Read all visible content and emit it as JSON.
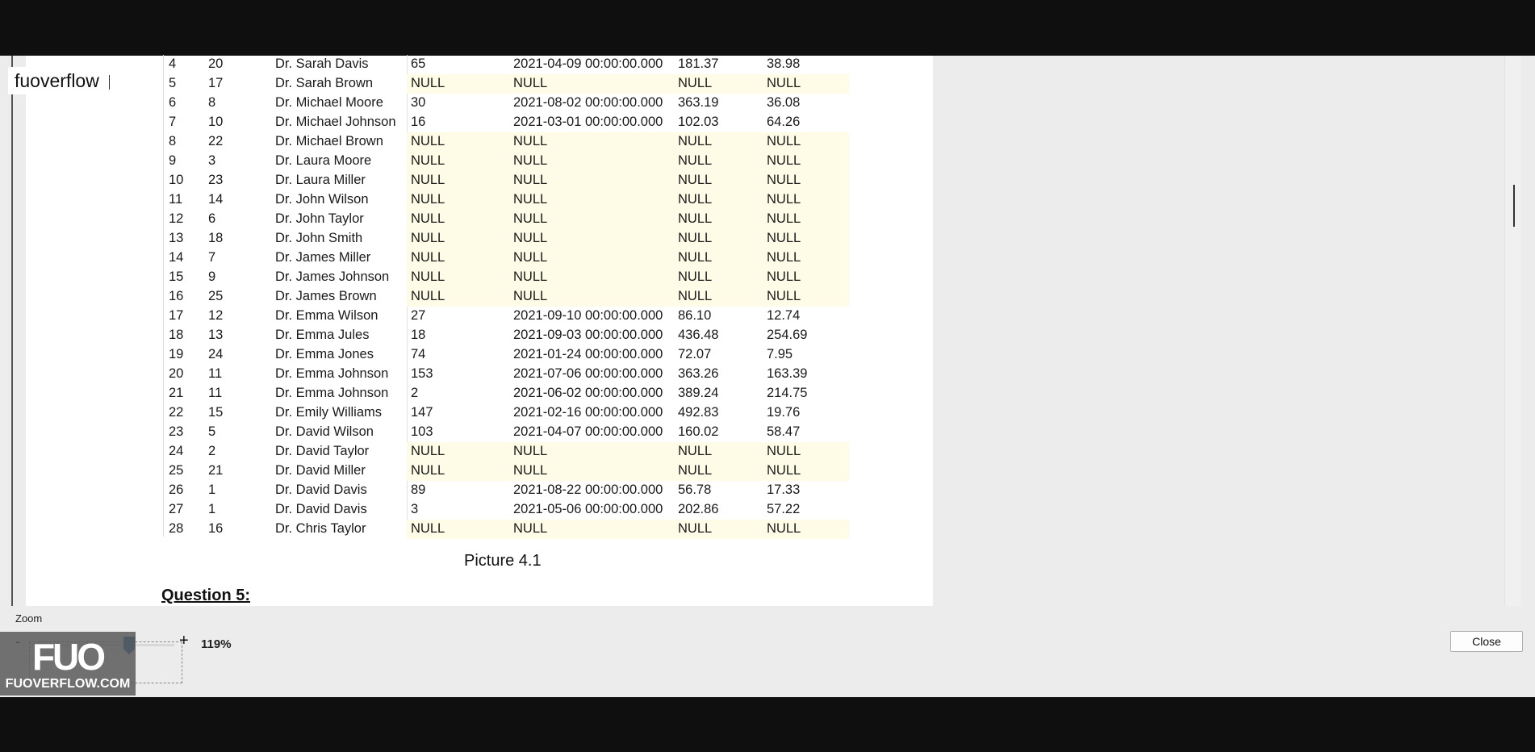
{
  "brand_tag": "fuoverflow",
  "table_rows": [
    [
      "4",
      "20",
      "Dr. Sarah Davis",
      "65",
      "2021-04-09 00:00:00.000",
      "181.37",
      "38.98"
    ],
    [
      "5",
      "17",
      "Dr. Sarah Brown",
      "NULL",
      "NULL",
      "NULL",
      "NULL"
    ],
    [
      "6",
      "8",
      "Dr. Michael Moore",
      "30",
      "2021-08-02 00:00:00.000",
      "363.19",
      "36.08"
    ],
    [
      "7",
      "10",
      "Dr. Michael Johnson",
      "16",
      "2021-03-01 00:00:00.000",
      "102.03",
      "64.26"
    ],
    [
      "8",
      "22",
      "Dr. Michael Brown",
      "NULL",
      "NULL",
      "NULL",
      "NULL"
    ],
    [
      "9",
      "3",
      "Dr. Laura Moore",
      "NULL",
      "NULL",
      "NULL",
      "NULL"
    ],
    [
      "10",
      "23",
      "Dr. Laura Miller",
      "NULL",
      "NULL",
      "NULL",
      "NULL"
    ],
    [
      "11",
      "14",
      "Dr. John Wilson",
      "NULL",
      "NULL",
      "NULL",
      "NULL"
    ],
    [
      "12",
      "6",
      "Dr. John Taylor",
      "NULL",
      "NULL",
      "NULL",
      "NULL"
    ],
    [
      "13",
      "18",
      "Dr. John Smith",
      "NULL",
      "NULL",
      "NULL",
      "NULL"
    ],
    [
      "14",
      "7",
      "Dr. James Miller",
      "NULL",
      "NULL",
      "NULL",
      "NULL"
    ],
    [
      "15",
      "9",
      "Dr. James Johnson",
      "NULL",
      "NULL",
      "NULL",
      "NULL"
    ],
    [
      "16",
      "25",
      "Dr. James Brown",
      "NULL",
      "NULL",
      "NULL",
      "NULL"
    ],
    [
      "17",
      "12",
      "Dr. Emma Wilson",
      "27",
      "2021-09-10 00:00:00.000",
      "86.10",
      "12.74"
    ],
    [
      "18",
      "13",
      "Dr. Emma Jules",
      "18",
      "2021-09-03 00:00:00.000",
      "436.48",
      "254.69"
    ],
    [
      "19",
      "24",
      "Dr. Emma Jones",
      "74",
      "2021-01-24 00:00:00.000",
      "72.07",
      "7.95"
    ],
    [
      "20",
      "11",
      "Dr. Emma Johnson",
      "153",
      "2021-07-06 00:00:00.000",
      "363.26",
      "163.39"
    ],
    [
      "21",
      "11",
      "Dr. Emma Johnson",
      "2",
      "2021-06-02 00:00:00.000",
      "389.24",
      "214.75"
    ],
    [
      "22",
      "15",
      "Dr. Emily Williams",
      "147",
      "2021-02-16 00:00:00.000",
      "492.83",
      "19.76"
    ],
    [
      "23",
      "5",
      "Dr. David Wilson",
      "103",
      "2021-04-07 00:00:00.000",
      "160.02",
      "58.47"
    ],
    [
      "24",
      "2",
      "Dr. David Taylor",
      "NULL",
      "NULL",
      "NULL",
      "NULL"
    ],
    [
      "25",
      "21",
      "Dr. David Miller",
      "NULL",
      "NULL",
      "NULL",
      "NULL"
    ],
    [
      "26",
      "1",
      "Dr. David Davis",
      "89",
      "2021-08-22 00:00:00.000",
      "56.78",
      "17.33"
    ],
    [
      "27",
      "1",
      "Dr. David Davis",
      "3",
      "2021-05-06 00:00:00.000",
      "202.86",
      "57.22"
    ],
    [
      "28",
      "16",
      "Dr. Chris Taylor",
      "NULL",
      "NULL",
      "NULL",
      "NULL"
    ]
  ],
  "caption": "Picture 4.1",
  "question_heading": "Question 5:",
  "zoom": {
    "label": "Zoom",
    "minus": "-",
    "plus": "+",
    "value": "119%"
  },
  "close_label": "Close",
  "watermark": {
    "logo": "FUO",
    "url": "FUOVERFLOW.COM"
  }
}
